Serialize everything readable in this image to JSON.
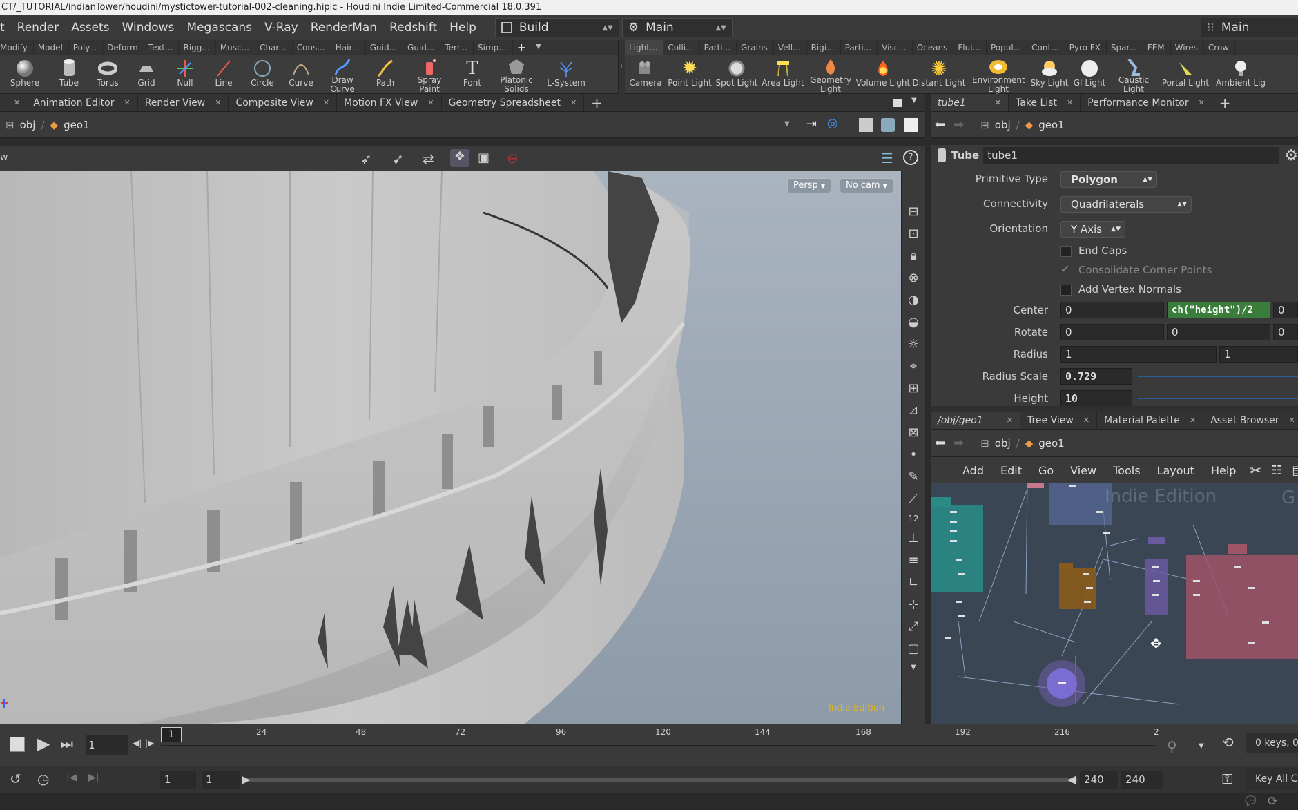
{
  "window": {
    "title": "CT/_TUTORIAL/indianTower/houdini/mystictower-tutorial-002-cleaning.hiplc - Houdini Indie Limited-Commercial 18.0.391"
  },
  "menu": {
    "items": [
      "t",
      "Render",
      "Assets",
      "Windows",
      "Megascans",
      "V-Ray",
      "RenderMan",
      "Redshift",
      "Help"
    ],
    "desktop": "Build",
    "desktop2": "Main",
    "desktop_right": "Main"
  },
  "shelf_left": {
    "tabs": [
      "Modify",
      "Model",
      "Poly...",
      "Deform",
      "Text...",
      "Rigg...",
      "Musc...",
      "Char...",
      "Cons...",
      "Hair...",
      "Guid...",
      "Guid...",
      "Terr...",
      "Simp..."
    ],
    "tools": [
      {
        "label": "Sphere",
        "icon": "sphere-icon"
      },
      {
        "label": "Tube",
        "icon": "tube-icon"
      },
      {
        "label": "Torus",
        "icon": "torus-icon"
      },
      {
        "label": "Grid",
        "icon": "grid-icon"
      },
      {
        "label": "Null",
        "icon": "null-icon"
      },
      {
        "label": "Line",
        "icon": "line-icon"
      },
      {
        "label": "Circle",
        "icon": "circle-icon"
      },
      {
        "label": "Curve",
        "icon": "curve-icon"
      },
      {
        "label": "Draw Curve",
        "icon": "draw-curve-icon"
      },
      {
        "label": "Path",
        "icon": "path-icon"
      },
      {
        "label": "Spray Paint",
        "icon": "spray-paint-icon"
      },
      {
        "label": "Font",
        "icon": "font-icon"
      },
      {
        "label": "Platonic Solids",
        "icon": "platonic-solids-icon"
      },
      {
        "label": "L-System",
        "icon": "l-system-icon"
      }
    ]
  },
  "shelf_right": {
    "tabs": [
      "Light...",
      "Colli...",
      "Parti...",
      "Grains",
      "Vell...",
      "Rigi...",
      "Parti...",
      "Visc...",
      "Oceans",
      "Flui...",
      "Popul...",
      "Cont...",
      "Pyro FX",
      "Spar...",
      "FEM",
      "Wires",
      "Crow"
    ],
    "tools": [
      {
        "label": "Camera",
        "icon": "camera-icon"
      },
      {
        "label": "Point Light",
        "icon": "point-light-icon"
      },
      {
        "label": "Spot Light",
        "icon": "spot-light-icon"
      },
      {
        "label": "Area Light",
        "icon": "area-light-icon"
      },
      {
        "label": "Geometry Light",
        "icon": "geometry-light-icon"
      },
      {
        "label": "Volume Light",
        "icon": "volume-light-icon"
      },
      {
        "label": "Distant Light",
        "icon": "distant-light-icon"
      },
      {
        "label": "Environment Light",
        "icon": "environment-light-icon"
      },
      {
        "label": "Sky Light",
        "icon": "sky-light-icon"
      },
      {
        "label": "GI Light",
        "icon": "gi-light-icon"
      },
      {
        "label": "Caustic Light",
        "icon": "caustic-light-icon"
      },
      {
        "label": "Portal Light",
        "icon": "portal-light-icon"
      },
      {
        "label": "Ambient Lig",
        "icon": "ambient-light-icon"
      }
    ]
  },
  "left_panes": {
    "tabs": [
      "Animation Editor",
      "Render View",
      "Composite View",
      "Motion FX View",
      "Geometry Spreadsheet"
    ]
  },
  "left_path": {
    "obj": "obj",
    "geo": "geo1"
  },
  "viewport": {
    "persp": "Persp",
    "cam": "No cam",
    "watermark": "Indie Edition",
    "label_w": "w"
  },
  "param_panes": {
    "tabs": [
      "tube1",
      "Take List",
      "Performance Monitor"
    ]
  },
  "param_path": {
    "obj": "obj",
    "geo": "geo1"
  },
  "params": {
    "node_type": "Tube",
    "node_name": "tube1",
    "primitive_type": {
      "label": "Primitive Type",
      "value": "Polygon"
    },
    "connectivity": {
      "label": "Connectivity",
      "value": "Quadrilaterals"
    },
    "orientation": {
      "label": "Orientation",
      "value": "Y Axis"
    },
    "end_caps": "End Caps",
    "consolidate": "Consolidate Corner Points",
    "vertex_normals": "Add Vertex Normals",
    "center": {
      "label": "Center",
      "x": "0",
      "y": "ch(\"height\")/2",
      "z": "0"
    },
    "rotate": {
      "label": "Rotate",
      "x": "0",
      "y": "0",
      "z": "0"
    },
    "radius": {
      "label": "Radius",
      "a": "1",
      "b": "1"
    },
    "radius_scale": {
      "label": "Radius Scale",
      "value": "0.729"
    },
    "height": {
      "label": "Height",
      "value": "10"
    }
  },
  "net_panes": {
    "tabs": [
      "/obj/geo1",
      "Tree View",
      "Material Palette",
      "Asset Browser"
    ]
  },
  "net_path": {
    "obj": "obj",
    "geo": "geo1"
  },
  "net_menu": [
    "Add",
    "Edit",
    "Go",
    "View",
    "Tools",
    "Layout",
    "Help"
  ],
  "net_watermark": "Indie Edition",
  "net_watermark2": "G",
  "timeline": {
    "current_frame": "1",
    "marker": "1",
    "ticks": [
      "24",
      "48",
      "72",
      "96",
      "120",
      "144",
      "168",
      "192",
      "216",
      "2"
    ],
    "keys": "0 keys, 0",
    "key_all": "Key All Ch"
  },
  "range": {
    "start": "1",
    "start2": "1",
    "end": "240",
    "end2": "240"
  },
  "colors": {
    "accent_green": "#3a7d3a",
    "viewport_top": "#a9b4bf",
    "net_bg": "#3b4654"
  }
}
